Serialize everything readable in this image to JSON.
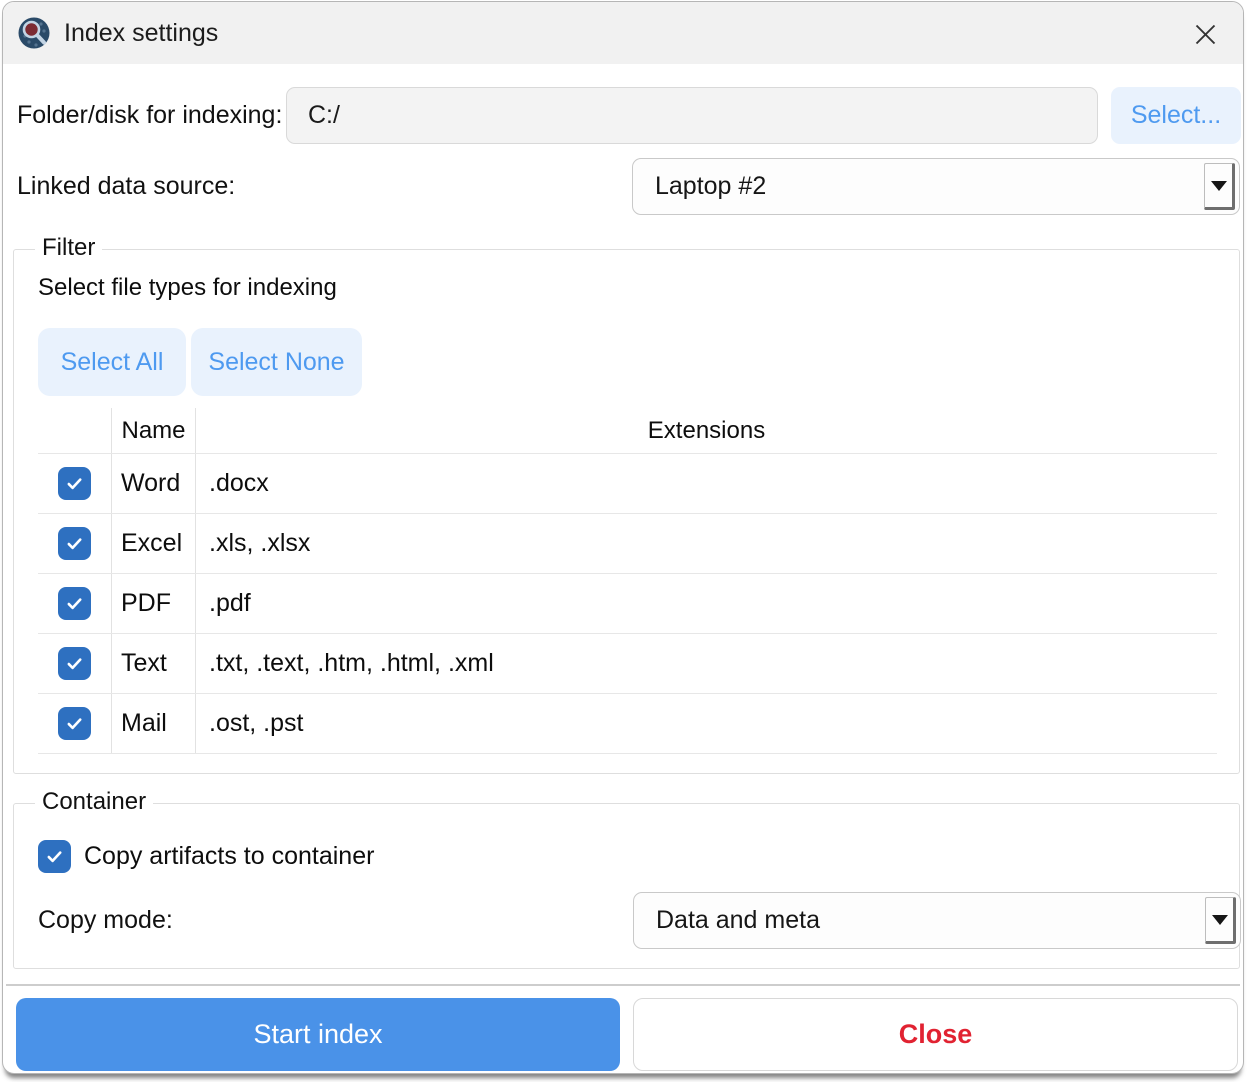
{
  "window": {
    "title": "Index settings"
  },
  "folder_row": {
    "label": "Folder/disk for indexing:",
    "value": "C:/",
    "select_button": "Select..."
  },
  "linked_source": {
    "label": "Linked data source:",
    "value": "Laptop #2"
  },
  "filter": {
    "legend": "Filter",
    "description": "Select file types for indexing",
    "select_all": "Select All",
    "select_none": "Select None",
    "table": {
      "headers": {
        "name": "Name",
        "extensions": "Extensions"
      },
      "rows": [
        {
          "checked": true,
          "name": "Word",
          "extensions": ".docx"
        },
        {
          "checked": true,
          "name": "Excel",
          "extensions": ".xls, .xlsx"
        },
        {
          "checked": true,
          "name": "PDF",
          "extensions": ".pdf"
        },
        {
          "checked": true,
          "name": "Text",
          "extensions": ".txt, .text, .htm, .html, .xml"
        },
        {
          "checked": true,
          "name": "Mail",
          "extensions": ".ost, .pst"
        }
      ]
    }
  },
  "container": {
    "legend": "Container",
    "copy_artifacts": {
      "label": "Copy artifacts to container",
      "checked": true
    },
    "copy_mode": {
      "label": "Copy mode:",
      "value": "Data and meta"
    }
  },
  "footer": {
    "start_button": "Start index",
    "close_button": "Close"
  },
  "colors": {
    "accent": "#4a92e8",
    "btn-blue-bg": "#e9f2fd",
    "btn-blue-text": "#4e9af0",
    "check": "#2e70c0",
    "close-red": "#e12231",
    "border-gray": "#dedede",
    "titlebar": "#f1f1f1"
  }
}
